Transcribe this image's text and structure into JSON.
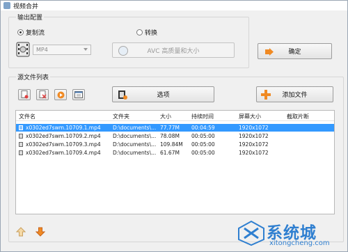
{
  "window": {
    "title": "视频合并"
  },
  "output": {
    "group_title": "输出配置",
    "radio_copy": "复制流",
    "radio_convert": "转换",
    "format": "MP4",
    "quality_button": "AVC 高质量和大小",
    "ok_button": "确定"
  },
  "sources": {
    "group_title": "源文件列表",
    "options_button": "选项",
    "add_button": "添加文件",
    "columns": [
      "文件名",
      "文件夹",
      "大小",
      "持续时间",
      "屏幕大小",
      "截取片断"
    ],
    "rows": [
      {
        "name": "x0302ed7swm.10709.1.mp4",
        "folder": "D:\\documents\\...",
        "size": "77.77M",
        "duration": "00:04:59",
        "screen": "1920x1072",
        "clip": ""
      },
      {
        "name": "x0302ed7swm.10709.2.mp4",
        "folder": "D:\\documents\\...",
        "size": "78.08M",
        "duration": "00:05:00",
        "screen": "1920x1072",
        "clip": ""
      },
      {
        "name": "x0302ed7swm.10709.3.mp4",
        "folder": "D:\\documents\\...",
        "size": "109.84M",
        "duration": "00:05:00",
        "screen": "1920x1072",
        "clip": ""
      },
      {
        "name": "x0302ed7swm.10709.4.mp4",
        "folder": "D:\\documents\\...",
        "size": "61.67M",
        "duration": "00:05:00",
        "screen": "1920x1072",
        "clip": ""
      }
    ]
  },
  "watermark": {
    "brand": "系统城",
    "site": "xitongcheng.com"
  },
  "colors": {
    "selection": "#3399ff",
    "accent_orange": "#f08a24"
  }
}
